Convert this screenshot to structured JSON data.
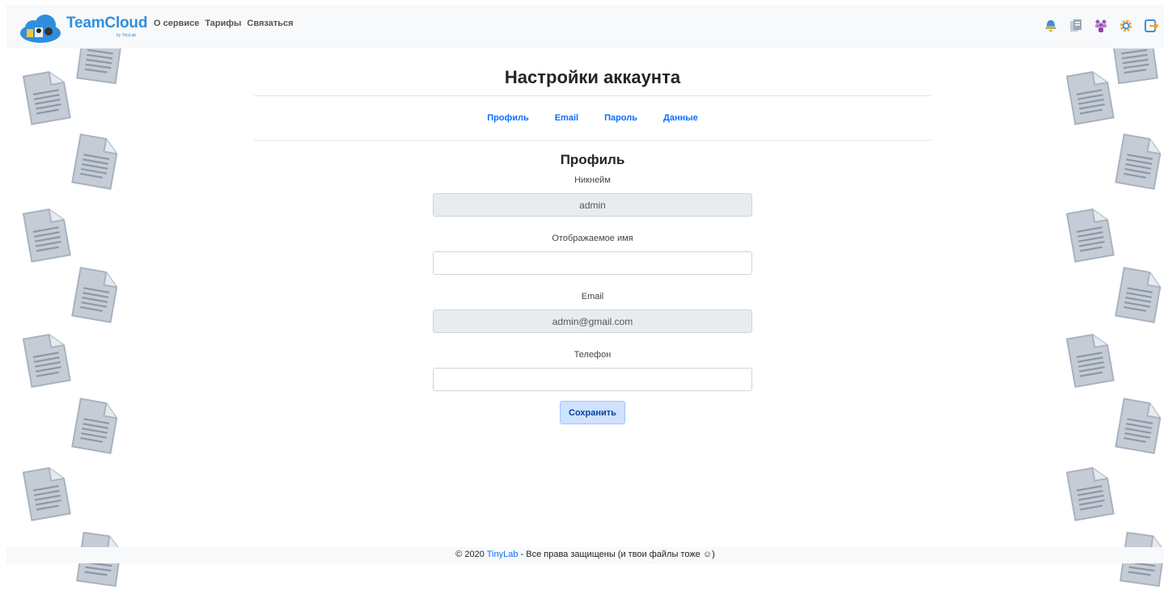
{
  "navbar": {
    "brand": "TeamCloud",
    "brand_sub": "by TinyLab",
    "links": [
      "О сервисе",
      "Тарифы",
      "Связаться"
    ],
    "icons": [
      "bell-icon",
      "files-icon",
      "users-icon",
      "gear-icon",
      "logout-icon"
    ]
  },
  "page": {
    "title": "Настройки аккаунта",
    "tabs": [
      "Профиль",
      "Email",
      "Пароль",
      "Данные"
    ]
  },
  "profile": {
    "title": "Профиль",
    "nickname_label": "Никнейм",
    "nickname_value": "admin",
    "display_name_label": "Отображаемое имя",
    "display_name_value": "",
    "email_label": "Email",
    "email_value": "admin@gmail.com",
    "phone_label": "Телефон",
    "phone_value": "",
    "save_label": "Сохранить"
  },
  "footer": {
    "prefix": "© 2020 ",
    "link": "TinyLab",
    "suffix": " - Все права защищены (и твои файлы тоже ☺)"
  },
  "colors": {
    "brand": "#2f8fde",
    "link": "#0d6efd",
    "doc_icon": "#c5ccd6"
  }
}
